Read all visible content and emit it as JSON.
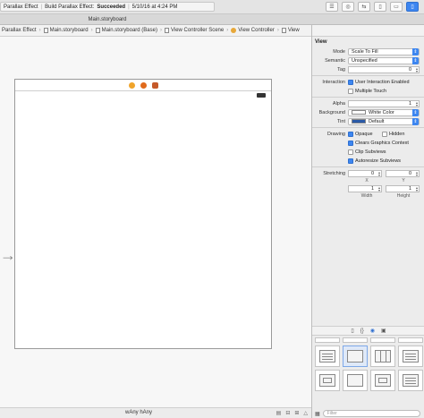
{
  "toolbar": {
    "scheme": "Parallax Effect",
    "status_prefix": "Build Parallax Effect:",
    "status_result": "Succeeded",
    "status_time": "5/10/16 at 4:24 PM"
  },
  "tab": {
    "title": "Main.storyboard"
  },
  "jumpbar": {
    "crumbs": [
      "Parallax Effect",
      "Main.storyboard",
      "Main.storyboard (Base)",
      "View Controller Scene",
      "View Controller",
      "View"
    ]
  },
  "bottombar": {
    "size_class": "wAny hAny"
  },
  "inspector": {
    "section": "View",
    "mode_label": "Mode",
    "mode_value": "Scale To Fill",
    "semantic_label": "Semantic",
    "semantic_value": "Unspecified",
    "tag_label": "Tag",
    "tag_value": "0",
    "interaction_label": "Interaction",
    "user_interaction": "User Interaction Enabled",
    "multiple_touch": "Multiple Touch",
    "alpha_label": "Alpha",
    "alpha_value": "1",
    "background_label": "Background",
    "background_value": "White Color",
    "tint_label": "Tint",
    "tint_value": "Default",
    "drawing_label": "Drawing",
    "opaque": "Opaque",
    "hidden": "Hidden",
    "clears_graphics": "Clears Graphics Context",
    "clip_subviews": "Clip Subviews",
    "autoresize": "Autoresize Subviews",
    "stretching_label": "Stretching",
    "stretch_x": "0",
    "stretch_y": "0",
    "stretch_w": "1",
    "stretch_h": "1",
    "x_label": "X",
    "y_label": "Y",
    "width_label": "Width",
    "height_label": "Height"
  },
  "library": {
    "filter_placeholder": "Filter"
  },
  "colors": {
    "accent": "#3d86f0",
    "tint_swatch": "#2a5aa8"
  }
}
